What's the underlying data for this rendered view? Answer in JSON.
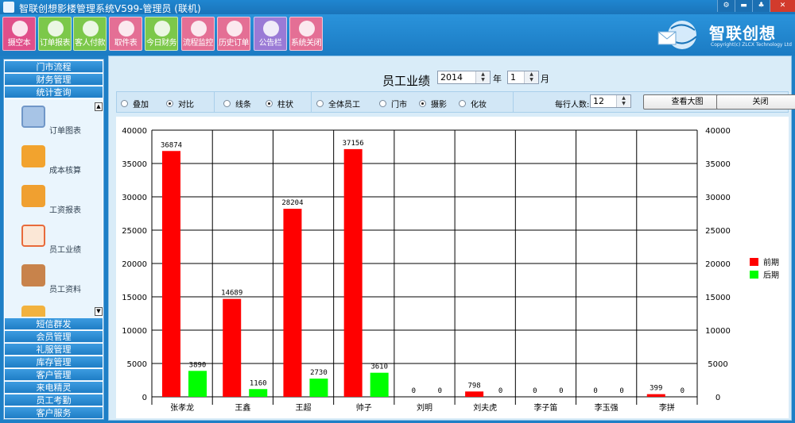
{
  "window": {
    "title": "智联创想影楼管理系统V599-管理员 (联机)",
    "buttons": [
      "⚙",
      "▬",
      "♣",
      "✕"
    ]
  },
  "toolbar": {
    "buttons": [
      {
        "label": "摄空本",
        "icon": "camera-icon",
        "color": "#e04f8a"
      },
      {
        "label": "订单报表",
        "icon": "order-report-icon",
        "color": "#7cc84a"
      },
      {
        "label": "客人付款",
        "icon": "payment-icon",
        "color": "#7cc84a"
      },
      {
        "label": "取件表",
        "icon": "pickup-icon",
        "color": "#e46f95"
      },
      {
        "label": "今日财务",
        "icon": "finance-icon",
        "color": "#7cc84a"
      },
      {
        "label": "流程监控",
        "icon": "process-monitor-icon",
        "color": "#e46f95"
      },
      {
        "label": "历史订单",
        "icon": "history-order-icon",
        "color": "#e46f95"
      },
      {
        "label": "公告栏",
        "icon": "notice-icon",
        "color": "#9a7ad6"
      },
      {
        "label": "系统关闭",
        "icon": "shutdown-icon",
        "color": "#e46f95"
      }
    ]
  },
  "logo": {
    "name": "智联创想",
    "subtitle": "Copyright(c) ZLCX Technology Ltd"
  },
  "sidebar": {
    "headers_top": [
      "门市流程",
      "财务管理",
      "统计查询"
    ],
    "items": [
      {
        "label": "订单图表",
        "icon": "order-chart-icon",
        "color": "#8fb4de"
      },
      {
        "label": "成本核算",
        "icon": "cost-icon",
        "color": "#f2a32e"
      },
      {
        "label": "工资报表",
        "icon": "salary-icon",
        "color": "#f0a030"
      },
      {
        "label": "员工业绩",
        "icon": "performance-icon",
        "color": "#e86a3a"
      },
      {
        "label": "员工资料",
        "icon": "staff-info-icon",
        "color": "#c8834b"
      }
    ],
    "headers_bottom": [
      "短信群发",
      "会员管理",
      "礼服管理",
      "库存管理",
      "客户管理",
      "来电精灵",
      "员工考勤",
      "客户服务"
    ]
  },
  "report": {
    "title": "员工业绩",
    "year": "2014",
    "year_label": "年",
    "month": "1",
    "month_label": "月",
    "mode_group": [
      {
        "label": "叠加",
        "checked": false
      },
      {
        "label": "对比",
        "checked": true
      }
    ],
    "style_group": [
      {
        "label": "线条",
        "checked": false
      },
      {
        "label": "柱状",
        "checked": true
      }
    ],
    "scope_group": [
      {
        "label": "全体员工",
        "checked": false
      },
      {
        "label": "门市",
        "checked": false
      },
      {
        "label": "摄影",
        "checked": true
      },
      {
        "label": "化妆",
        "checked": false
      }
    ],
    "per_row_label": "每行人数:",
    "per_row_value": "12",
    "view_large_button": "查看大图",
    "close_button": "关闭"
  },
  "chart_data": {
    "type": "bar",
    "categories": [
      "张孝龙",
      "王鑫",
      "王超",
      "帅子",
      "刘明",
      "刘夫虎",
      "李子笛",
      "李玉强",
      "李拼"
    ],
    "series": [
      {
        "name": "前期",
        "color": "#ff0000",
        "values": [
          36874,
          14689,
          28204,
          37156,
          0,
          798,
          0,
          0,
          399
        ]
      },
      {
        "name": "后期",
        "color": "#00ff00",
        "values": [
          3890,
          1160,
          2730,
          3610,
          0,
          0,
          0,
          0,
          0
        ]
      }
    ],
    "ylim": [
      0,
      40000
    ],
    "yticks": [
      0,
      5000,
      10000,
      15000,
      20000,
      25000,
      30000,
      35000,
      40000
    ],
    "grid": true,
    "legend_position": "right"
  }
}
